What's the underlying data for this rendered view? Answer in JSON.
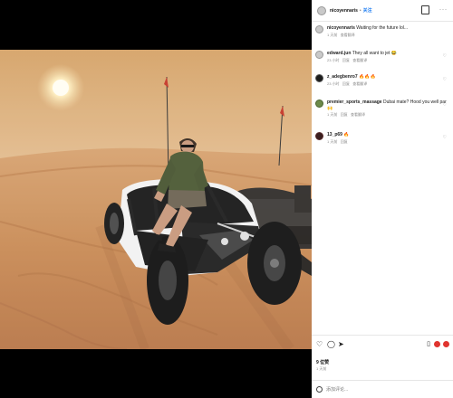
{
  "post": {
    "username": "nicoyennaris",
    "follow_label": "关注",
    "more_icon": "more-horizontal-icon",
    "caption": {
      "username": "nicoyennaris",
      "text": "Waiting for the future lol...",
      "time": "1 天前",
      "translate": "查看翻译"
    },
    "comments": [
      {
        "username": "edward.jun",
        "text": "They all want to jet 😂",
        "time": "23 小时",
        "reply": "回复",
        "translate": "查看翻译"
      },
      {
        "username": "z_adegbenro7",
        "text": "🔥🔥🔥",
        "time": "23 小时",
        "reply": "回复",
        "translate": "查看翻译"
      },
      {
        "username": "premier_sports_massage",
        "text": "Dubai mate? Hood you well par 🙌",
        "extra": "🙌",
        "time": "1 天前",
        "reply": "回复",
        "translate": "查看翻译"
      },
      {
        "username": "13_p69",
        "text": "🔥",
        "time": "1 天前",
        "reply": "回复"
      }
    ],
    "likes": "9 位赞",
    "posted": "1 天前",
    "add_comment_placeholder": "添加评论..."
  },
  "colors": {
    "follow_blue": "#1d7cf2",
    "like_red": "#e0342f"
  }
}
